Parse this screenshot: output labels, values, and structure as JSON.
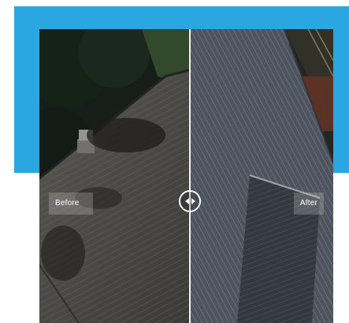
{
  "comparison": {
    "before_label": "Before",
    "after_label": "After",
    "slider_position": 0.51
  },
  "colors": {
    "accent": "#2aa7e0",
    "divider": "#f2f2f2"
  },
  "icons": {
    "handle": "left-right-arrows-icon"
  }
}
